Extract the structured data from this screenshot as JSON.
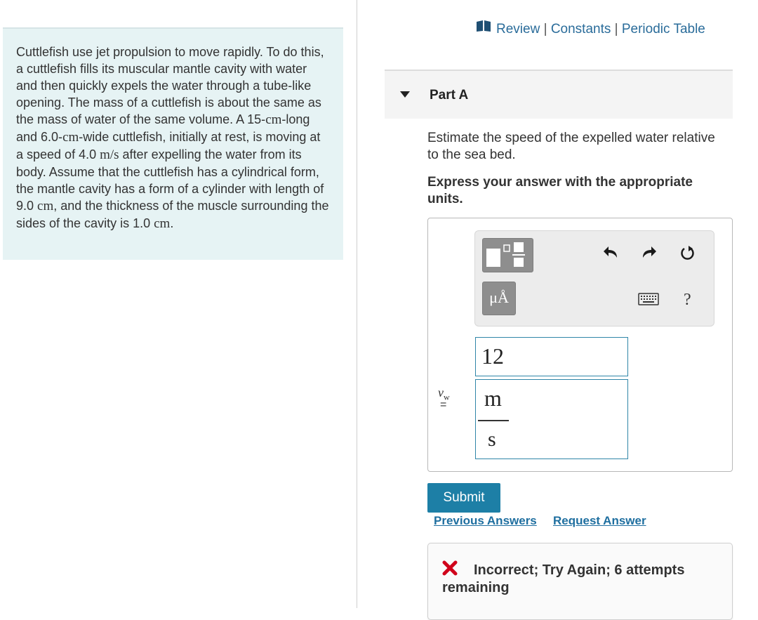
{
  "problem": {
    "t1": "Cuttlefish use jet propulsion to move rapidly. To do this, a cuttlefish fills its muscular mantle cavity with water and then quickly expels the water through a tube-like opening. The mass of a cuttlefish is about the same as the mass of water of the same volume. A 15-",
    "u1": "cm",
    "t2": "-long and 6.0-",
    "u2": "cm",
    "t3": "-wide cuttlefish, initially at rest, is moving at a speed of 4.0 ",
    "u3": "m/s",
    "t4": " after expelling the water from its body. Assume that the cuttlefish has a cylindrical form, the mantle cavity has a form of a cylinder with length of 9.0 ",
    "u4": "cm",
    "t5": ", and the thickness of the muscle surrounding the sides of the cavity is 1.0 ",
    "u5": "cm",
    "t6": "."
  },
  "top_links": {
    "review": "Review",
    "constants": "Constants",
    "periodic_table": "Periodic Table",
    "separator": " | "
  },
  "part": {
    "title": "Part A",
    "question": "Estimate the speed of the expelled water relative to the sea bed.",
    "instructions": "Express your answer with the appropriate units."
  },
  "toolbar": {
    "units_glyph": "μÅ",
    "help_glyph": "?",
    "icons": [
      "fraction-template-icon",
      "units-icon",
      "undo-icon",
      "redo-icon",
      "reset-icon",
      "keyboard-icon",
      "help-icon"
    ]
  },
  "answer": {
    "variable": "v",
    "variable_sub": "w",
    "equals": "=",
    "value": "12",
    "unit_numerator": "m",
    "unit_denominator": "s"
  },
  "actions": {
    "submit": "Submit",
    "previous_answers": "Previous Answers",
    "request_answer": "Request Answer"
  },
  "feedback": {
    "message": "Incorrect; Try Again; 6 attempts remaining",
    "icon": "x-mark-icon",
    "icon_color": "#d0021b"
  },
  "colors": {
    "accent": "#1d7fa6",
    "link": "#2a6c9a",
    "problem_bg": "#e6f3f4"
  }
}
